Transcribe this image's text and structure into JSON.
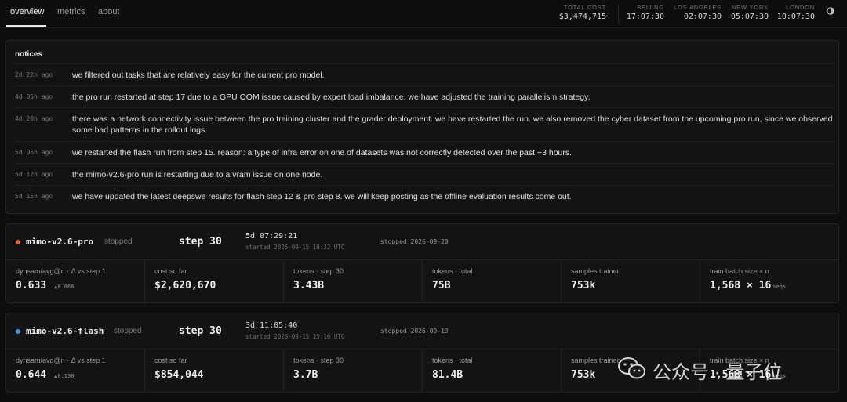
{
  "nav": {
    "items": [
      {
        "label": "overview",
        "active": true
      },
      {
        "label": "metrics",
        "active": false
      },
      {
        "label": "about",
        "active": false
      }
    ]
  },
  "header": {
    "total_cost": {
      "label": "TOTAL COST",
      "value": "$3,474,715"
    },
    "clocks": [
      {
        "city": "BEIJING",
        "time": "17:07:30"
      },
      {
        "city": "LOS ANGELES",
        "time": "02:07:30"
      },
      {
        "city": "NEW YORK",
        "time": "05:07:30"
      },
      {
        "city": "LONDON",
        "time": "10:07:30"
      }
    ],
    "theme_icon": "half-circle-icon"
  },
  "notices": {
    "title": "notices",
    "items": [
      {
        "time": "2d 22h ago",
        "text": "we filtered out tasks that are relatively easy for the current pro model."
      },
      {
        "time": "4d 05h ago",
        "text": "the pro run restarted at step 17 due to a GPU OOM issue caused by expert load imbalance. we have adjusted the training parallelism strategy."
      },
      {
        "time": "4d 20h ago",
        "text": "there was a network connectivity issue between the pro training cluster and the grader deployment. we have restarted the run. we also removed the cyber dataset from the upcoming pro run, since we observed some bad patterns in the rollout logs."
      },
      {
        "time": "5d 06h ago",
        "text": "we restarted the flash run from step 15. reason: a type of infra error on one of datasets was not correctly detected over the past ~3 hours."
      },
      {
        "time": "5d 12h ago",
        "text": "the mimo-v2.6-pro run is restarting due to a vram issue on one node."
      },
      {
        "time": "5d 15h ago",
        "text": "we have updated the latest deepswe results for flash step 12 & pro step 8. we will keep posting as the offline evaluation results come out."
      }
    ]
  },
  "runs": [
    {
      "name": "mimo-v2.6-pro",
      "dot_color": "#e0622e",
      "status": "stopped",
      "step": "step 30",
      "elapsed": "5d 07:29:21",
      "started": "started 2026-09-15 10:32 UTC",
      "stopped": "stopped 2026-09-20",
      "metrics": [
        {
          "label": "dynsam/avg@n · Δ vs step 1",
          "value": "0.633",
          "delta": "▲0.068",
          "unit": ""
        },
        {
          "label": "cost so far",
          "value": "$2,620,670",
          "delta": "",
          "unit": ""
        },
        {
          "label": "tokens · step 30",
          "value": "3.43B",
          "delta": "",
          "unit": ""
        },
        {
          "label": "tokens · total",
          "value": "75B",
          "delta": "",
          "unit": ""
        },
        {
          "label": "samples trained",
          "value": "753k",
          "delta": "",
          "unit": ""
        },
        {
          "label": "train batch size × n",
          "value": "1,568 × 16",
          "delta": "",
          "unit": "seqs"
        }
      ]
    },
    {
      "name": "mimo-v2.6-flash",
      "dot_color": "#4a8fe0",
      "status": "stopped",
      "step": "step 30",
      "elapsed": "3d 11:05:40",
      "started": "started 2026-09-15 15:16 UTC",
      "stopped": "stopped 2026-09-19",
      "metrics": [
        {
          "label": "dynsam/avg@n · Δ vs step 1",
          "value": "0.644",
          "delta": "▲0.130",
          "unit": ""
        },
        {
          "label": "cost so far",
          "value": "$854,044",
          "delta": "",
          "unit": ""
        },
        {
          "label": "tokens · step 30",
          "value": "3.7B",
          "delta": "",
          "unit": ""
        },
        {
          "label": "tokens · total",
          "value": "81.4B",
          "delta": "",
          "unit": ""
        },
        {
          "label": "samples trained",
          "value": "753k",
          "delta": "",
          "unit": ""
        },
        {
          "label": "train batch size × n",
          "value": "1,568 × 16",
          "delta": "",
          "unit": "seqs"
        }
      ]
    }
  ],
  "watermark": {
    "text": "公众号 · 量子位",
    "icon": "wechat-icon"
  }
}
